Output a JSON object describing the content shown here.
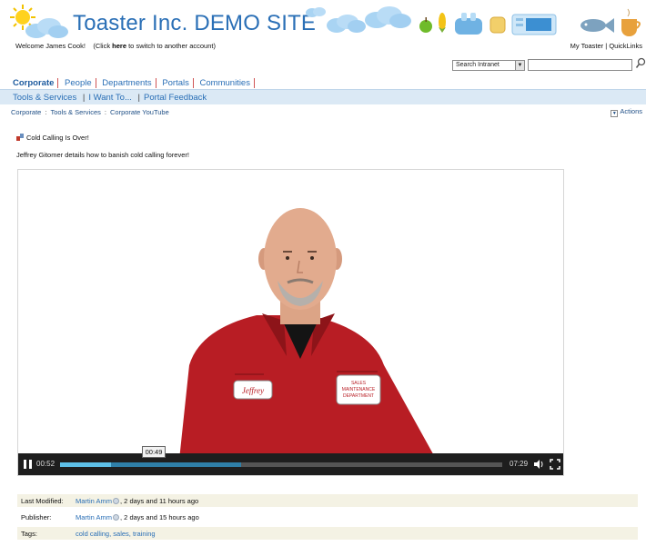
{
  "header": {
    "site_title": "Toaster Inc. DEMO SITE",
    "welcome_prefix": "Welcome James Cook!",
    "welcome_click_open": "(Click ",
    "welcome_click_here": "here",
    "welcome_click_rest": " to switch to another account)",
    "my_toaster": "My Toaster",
    "link_sep": " | ",
    "quicklinks": "QuickLinks"
  },
  "search": {
    "scope_value": "Search Intranet",
    "query_value": ""
  },
  "global_nav": {
    "tabs": [
      {
        "label": "Corporate",
        "active": true
      },
      {
        "label": "People",
        "active": false
      },
      {
        "label": "Departments",
        "active": false
      },
      {
        "label": "Portals",
        "active": false
      },
      {
        "label": "Communities",
        "active": false
      }
    ]
  },
  "sub_nav": {
    "items": [
      "Tools & Services",
      "I Want To...",
      "Portal Feedback"
    ],
    "separator": "|"
  },
  "breadcrumb": {
    "items": [
      "Corporate",
      "Tools & Services",
      "Corporate YouTube"
    ],
    "separator": ":"
  },
  "actions_label": "Actions",
  "content": {
    "title": "Cold Calling Is Over!",
    "description": "Jeffrey Gitomer details how to banish cold calling forever!"
  },
  "video": {
    "current_time": "00:52",
    "hover_time": "00:49",
    "duration": "07:29",
    "played_fraction": 0.116,
    "buffered_fraction": 0.41,
    "badge_left_text": "Jeffrey",
    "badge_right_lines": [
      "SALES",
      "MAINTENANCE",
      "DEPARTMENT"
    ]
  },
  "metadata": {
    "last_modified_label": "Last Modified:",
    "last_modified_user": "Martin Amm",
    "last_modified_when": ", 2 days and 11 hours ago",
    "publisher_label": "Publisher:",
    "publisher_user": "Martin Amm",
    "publisher_when": ", 2 days and 15 hours ago",
    "tags_label": "Tags:",
    "tags_value": "cold calling, sales, training"
  },
  "colors": {
    "title_blue": "#2a6fb6",
    "subnav_bg": "#dbe9f5",
    "shirt_red": "#b81d24",
    "meta_shade": "#f4f2e4"
  }
}
